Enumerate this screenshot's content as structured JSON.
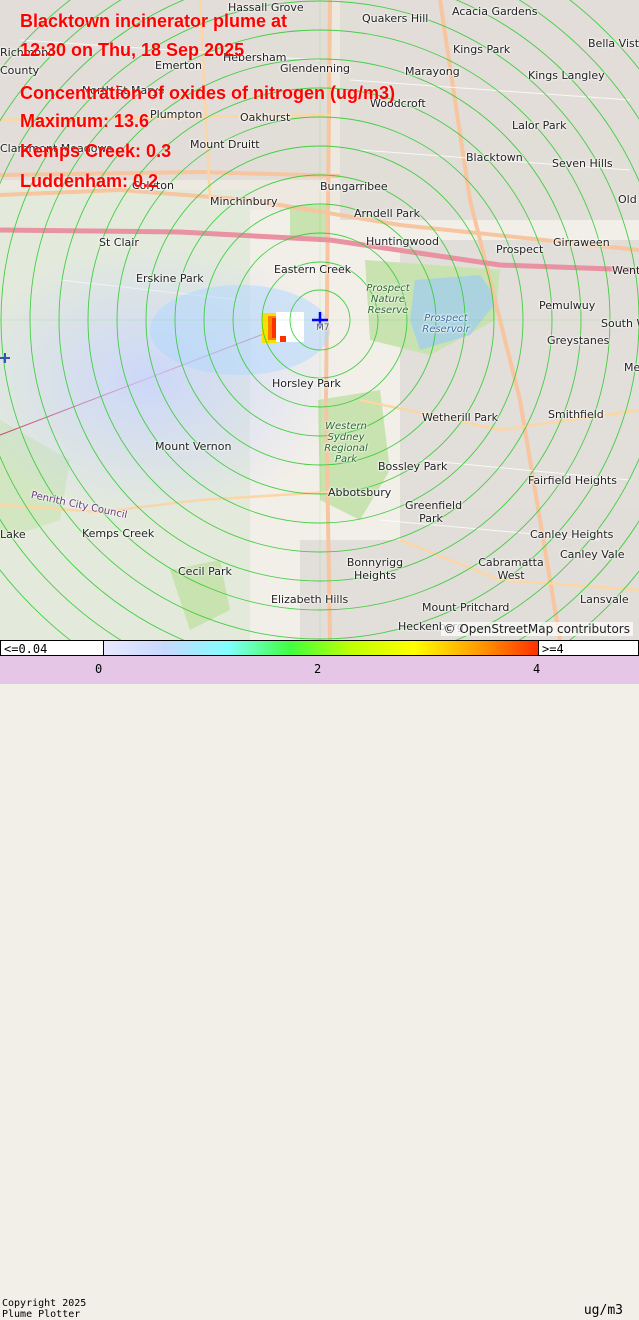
{
  "header": {
    "line1": "Blacktown incinerator plume at",
    "line2": "12:30 on Thu, 18 Sep 2025",
    "line3": "Concentration of oxides of nitrogen (ug/m3)",
    "line4": "Maximum: 13.6",
    "line5": "Kemps Creek: 0.3",
    "line6": "Luddenham: 0.2"
  },
  "map": {
    "places": [
      "Hassall Grove",
      "Quakers Hill",
      "Acacia Gardens",
      "Bella Vista",
      "Kings Park",
      "Richmond",
      "Emerton",
      "Hebersham",
      "Glendenning",
      "Marayong",
      "Kings Langley",
      "County",
      "North St Marys",
      "Woodcroft",
      "Lalor Park",
      "Plumpton",
      "Oakhurst",
      "Mount Druitt",
      "Blacktown",
      "Seven Hills",
      "Claremont Meadows",
      "Colyton",
      "Bungarribee",
      "Old",
      "Minchinbury",
      "Arndell Park",
      "St Clair",
      "Huntingwood",
      "Prospect",
      "Girraween",
      "Went",
      "Erskine Park",
      "Eastern Creek",
      "Pemulwuy",
      "South W",
      "Greystanes",
      "Horsley Park",
      "Mer",
      "Wetherill Park",
      "Smithfield",
      "Mount Vernon",
      "Bossley Park",
      "Fairfield Heights",
      "Abbotsbury",
      "Greenfield Park",
      "Penrith City Council",
      "Kemps Creek",
      "Canley Heights",
      "Canley Vale",
      "Bonnyrigg Heights",
      "Cabramatta West",
      "Cecil Park",
      "Elizabeth Hills",
      "Mount Pritchard",
      "Heckenberg",
      "Lansvale",
      "Lake"
    ],
    "parks": [
      "Prospect Nature Reserve",
      "Western Sydney Regional Park"
    ],
    "water": [
      "Prospect Reservoir"
    ],
    "road_shield": "M7",
    "attribution": "© OpenStreetMap contributors",
    "colors": {
      "title": "#ff0000",
      "contour": "#33cc33",
      "marker": "#0000ff",
      "legend_bg": "#e6c6e6"
    }
  },
  "legend": {
    "min_label": "<=0.04",
    "max_label": ">=4",
    "ticks": [
      "0",
      "2",
      "4"
    ],
    "units": "ug/m3",
    "copyright_line1": "Copyright 2025",
    "copyright_line2": "Plume Plotter",
    "scale": {
      "min": 0.04,
      "max": 4
    },
    "gradient_colors": [
      "#e8e8ff",
      "#c8d8ff",
      "#80ffff",
      "#40ff40",
      "#c0ff00",
      "#ffff00",
      "#ffa000",
      "#ff3000"
    ]
  }
}
